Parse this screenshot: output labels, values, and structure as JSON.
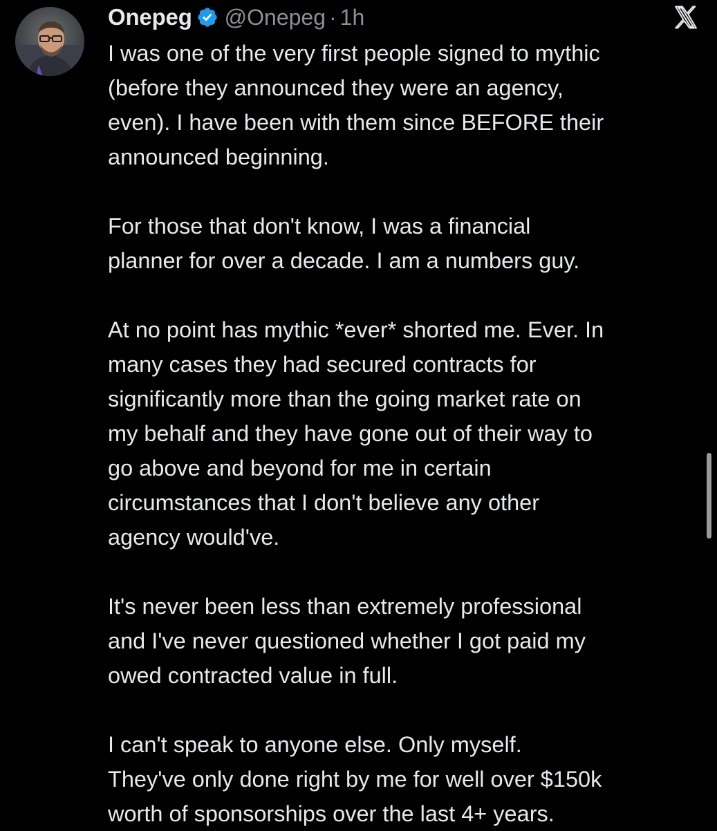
{
  "author": {
    "display_name": "Onepeg",
    "handle": "@Onepeg",
    "separator": "·",
    "time": "1h",
    "verified": true,
    "verified_color": "#1d9bf0"
  },
  "icons": {
    "avatar": "user-avatar-photo",
    "verified": "verified-badge-icon",
    "close": "x-logo-icon"
  },
  "tweet": {
    "paragraphs": [
      [
        "I was one of the very first people signed to mythic",
        "(before they announced they were an agency,",
        "even).  I have been with them since BEFORE their",
        "announced beginning."
      ],
      [
        "For those that don't know, I was a financial",
        "planner for over a decade.  I am a numbers guy."
      ],
      [
        "At no point has mythic *ever* shorted me. Ever.  In",
        "many cases they had secured contracts for",
        "significantly more than the going market rate on",
        "my behalf and they have gone out of their way to",
        "go above and beyond for me in certain",
        "circumstances that I don't believe any other",
        "agency would've."
      ],
      [
        "It's never been less than extremely professional",
        "and I've never questioned whether I got paid my",
        "owed contracted value in full."
      ],
      [
        "I can't speak to anyone else.  Only myself.",
        "They've only done right by me for well over $150k",
        "worth of sponsorships over the last 4+ years."
      ]
    ]
  },
  "colors": {
    "background": "#000000",
    "text": "#e7e9ea",
    "secondary_text": "#8b9197"
  }
}
